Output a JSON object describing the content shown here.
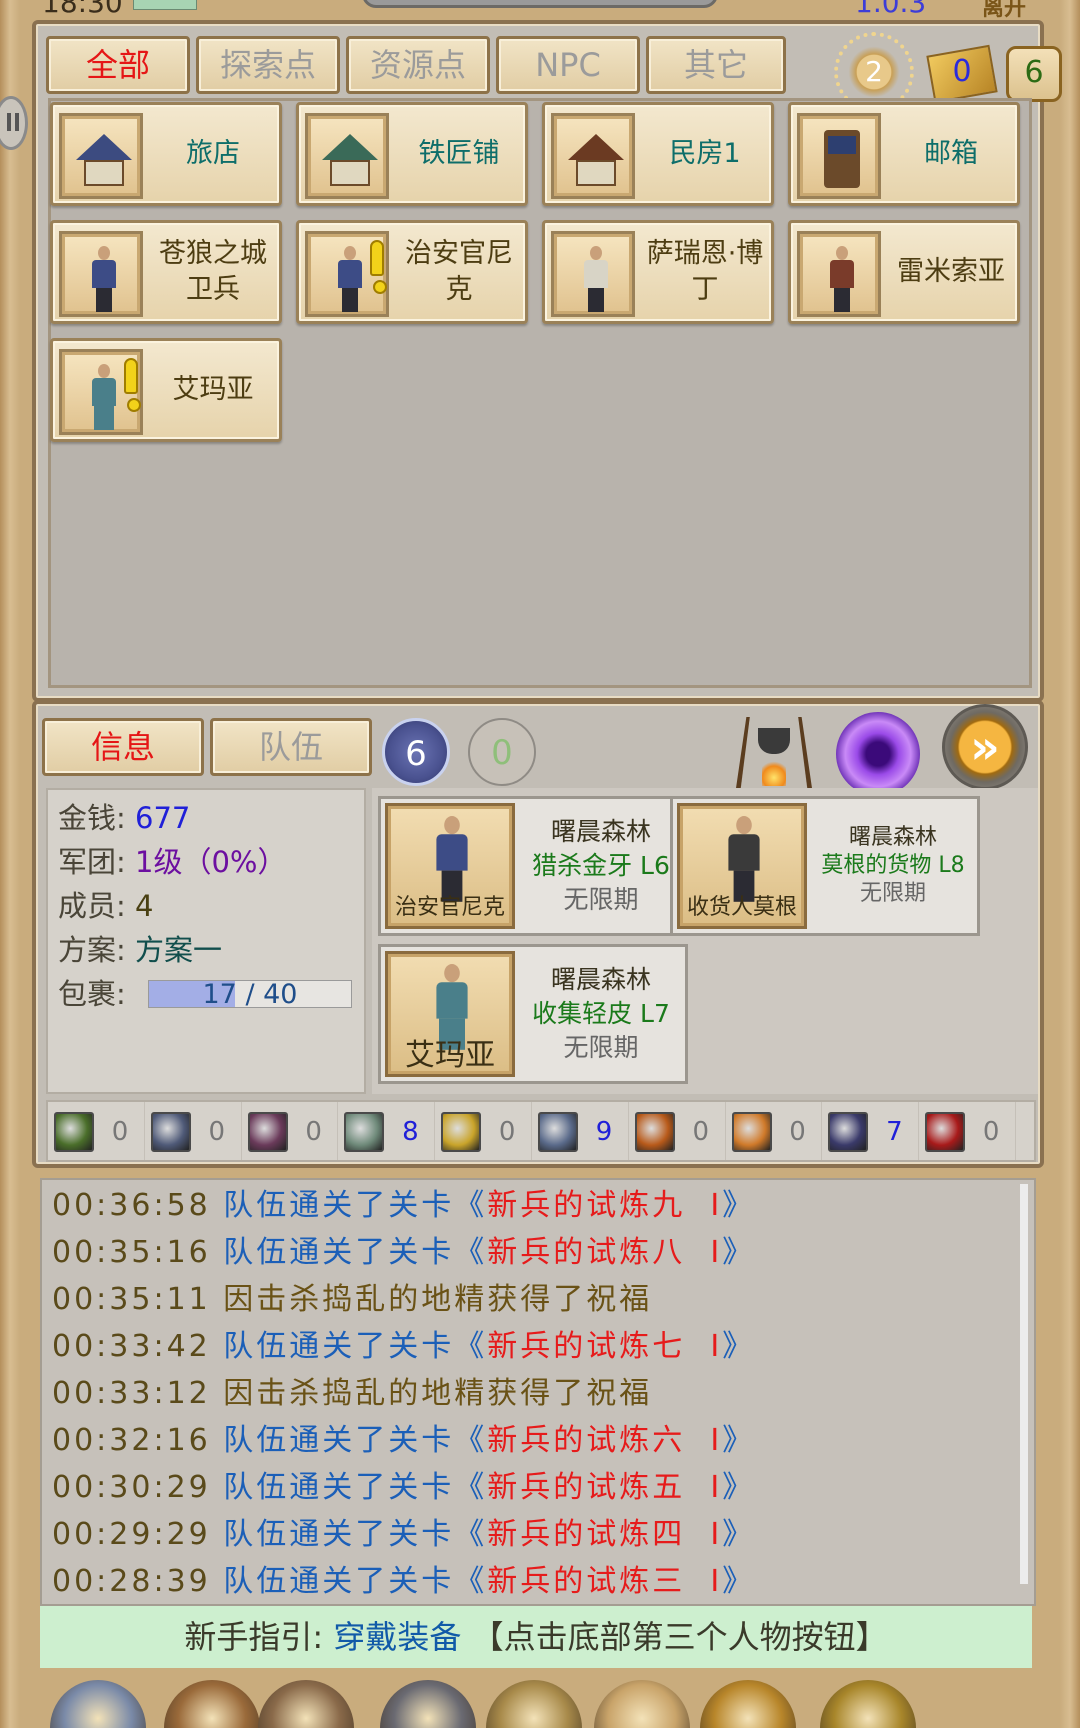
{
  "status_bar": {
    "time": "18:30",
    "version": "1.0.3",
    "leave_label": "离开"
  },
  "map_tabs": [
    {
      "label": "全部",
      "active": true
    },
    {
      "label": "探索点",
      "active": false
    },
    {
      "label": "资源点",
      "active": false
    },
    {
      "label": "NPC",
      "active": false
    },
    {
      "label": "其它",
      "active": false
    }
  ],
  "map_counters": {
    "sun": "2",
    "mail": "0",
    "scroll": "6"
  },
  "locations": [
    {
      "label": "旅店",
      "type": "building",
      "icon": "inn-icon"
    },
    {
      "label": "铁匠铺",
      "type": "building",
      "icon": "blacksmith-icon"
    },
    {
      "label": "民房1",
      "type": "building",
      "icon": "house-icon"
    },
    {
      "label": "邮箱",
      "type": "building",
      "icon": "mailbox-icon"
    },
    {
      "label": "苍狼之城\n卫兵",
      "type": "npc",
      "icon": "guard-icon",
      "quest": false
    },
    {
      "label": "治安官尼\n克",
      "type": "npc",
      "icon": "sheriff-icon",
      "quest": true
    },
    {
      "label": "萨瑞恩·博\n丁",
      "type": "npc",
      "icon": "villager-icon",
      "quest": false
    },
    {
      "label": "雷米索亚",
      "type": "npc",
      "icon": "villager-icon",
      "quest": false
    },
    {
      "label": "艾玛亚",
      "type": "npc",
      "icon": "woman-icon",
      "quest": true
    }
  ],
  "info_tabs": [
    {
      "label": "信息",
      "active": true
    },
    {
      "label": "队伍",
      "active": false
    }
  ],
  "badges": {
    "team": "6",
    "other": "0"
  },
  "stats": {
    "gold_label": "金钱:",
    "gold": "677",
    "legion_label": "军团:",
    "legion": "1级（0%）",
    "members_label": "成员:",
    "members": "4",
    "plan_label": "方案:",
    "plan": "方案一",
    "bag_label": "包裹:",
    "bag_text": "17 / 40",
    "bag_fraction": 0.425
  },
  "quests": [
    {
      "npc": "治安官尼克",
      "zone": "曙晨森林",
      "task": "猎杀金牙 L6",
      "period": "无限期"
    },
    {
      "npc": "收货人莫根",
      "zone": "曙晨森林",
      "task": "莫根的货物 L8",
      "period": "无限期"
    },
    {
      "npc": "艾玛亚",
      "zone": "曙晨森林",
      "task": "收集轻皮 L7",
      "period": "无限期"
    }
  ],
  "materials": [
    {
      "icon": "herb-icon",
      "count": "0",
      "color": "#4a6e2a"
    },
    {
      "icon": "axe-icon",
      "count": "0",
      "color": "#4f5a78"
    },
    {
      "icon": "hook-icon",
      "count": "0",
      "color": "#6a3a5a"
    },
    {
      "icon": "stone-icon",
      "count": "8",
      "color": "#6f8a7a"
    },
    {
      "icon": "gear-ore-icon",
      "count": "0",
      "color": "#c9a42a"
    },
    {
      "icon": "anvil-icon",
      "count": "9",
      "color": "#5a6a8a"
    },
    {
      "icon": "scroll-mat-icon",
      "count": "0",
      "color": "#b85a1a"
    },
    {
      "icon": "meat-icon",
      "count": "0",
      "color": "#d07a2a"
    },
    {
      "icon": "potion-icon",
      "count": "7",
      "color": "#3a3a6a"
    },
    {
      "icon": "blood-icon",
      "count": "0",
      "color": "#a81a1a"
    }
  ],
  "log": [
    {
      "time": "00:36:58",
      "prefix": "队伍通关了关卡《",
      "stage": "新兵的试炼九  I",
      "suffix": "》",
      "kind": "clear"
    },
    {
      "time": "00:35:16",
      "prefix": "队伍通关了关卡《",
      "stage": "新兵的试炼八  I",
      "suffix": "》",
      "kind": "clear"
    },
    {
      "time": "00:35:11",
      "prefix": "因击杀捣乱的地精获得了祝福",
      "stage": "",
      "suffix": "",
      "kind": "bless"
    },
    {
      "time": "00:33:42",
      "prefix": "队伍通关了关卡《",
      "stage": "新兵的试炼七  I",
      "suffix": "》",
      "kind": "clear"
    },
    {
      "time": "00:33:12",
      "prefix": "因击杀捣乱的地精获得了祝福",
      "stage": "",
      "suffix": "",
      "kind": "bless"
    },
    {
      "time": "00:32:16",
      "prefix": "队伍通关了关卡《",
      "stage": "新兵的试炼六  I",
      "suffix": "》",
      "kind": "clear"
    },
    {
      "time": "00:30:29",
      "prefix": "队伍通关了关卡《",
      "stage": "新兵的试炼五  I",
      "suffix": "》",
      "kind": "clear"
    },
    {
      "time": "00:29:29",
      "prefix": "队伍通关了关卡《",
      "stage": "新兵的试炼四  I",
      "suffix": "》",
      "kind": "clear"
    },
    {
      "time": "00:28:39",
      "prefix": "队伍通关了关卡《",
      "stage": "新兵的试炼三  I",
      "suffix": "》",
      "kind": "clear"
    }
  ],
  "guide": {
    "label": "新手指引:",
    "link": "穿戴装备",
    "hint": "【点击底部第三个人物按钮】"
  },
  "bottom_nav": [
    {
      "icon": "hero-icon",
      "color": "#7a8aa8"
    },
    {
      "icon": "chest-icon",
      "color": "#9a6a3a"
    },
    {
      "icon": "warrior-icon",
      "color": "#8a6a4a"
    },
    {
      "icon": "helmet-icon",
      "color": "#6a6a72"
    },
    {
      "icon": "compass-icon",
      "color": "#a88a4a"
    },
    {
      "icon": "quest-scroll-icon",
      "color": "#c9a46a"
    },
    {
      "icon": "trophy-icon",
      "color": "#b8862a"
    },
    {
      "icon": "settings-gear-icon",
      "color": "#a8862a"
    }
  ]
}
